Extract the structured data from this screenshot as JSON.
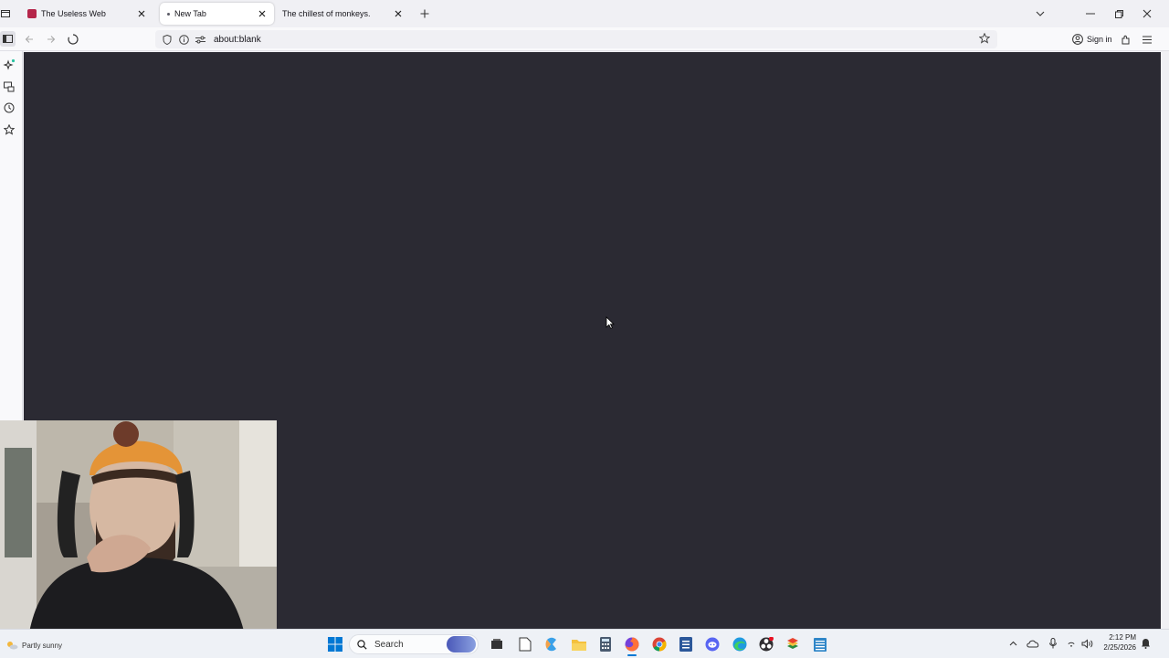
{
  "browser": {
    "tabs": [
      {
        "label": "The Useless Web",
        "active": false,
        "favicon_color": "#b5254a"
      },
      {
        "label": "New Tab",
        "active": true
      },
      {
        "label": "The chillest of monkeys.",
        "active": false
      }
    ],
    "url": "about:blank",
    "signin_label": "Sign in"
  },
  "taskbar": {
    "weather_label": "Partly sunny",
    "search_placeholder": "Search",
    "time": "2:12 PM",
    "date": "2/25/2026"
  },
  "colors": {
    "content_bg": "#2b2a33",
    "chrome_bg": "#f0f0f4",
    "taskbar_bg": "#eef1f6",
    "windows_blue": "#0078d4"
  },
  "icons": {
    "tabbar": [
      "tab-list-icon",
      "close-icon",
      "plus-icon",
      "chevron-down-icon",
      "minimize-icon",
      "maximize-icon"
    ],
    "navbar": [
      "back-icon",
      "forward-icon",
      "stop-icon",
      "shield-icon",
      "info-icon",
      "permissions-icon",
      "bookmark-star-icon",
      "account-icon",
      "extensions-icon",
      "menu-icon"
    ],
    "sidebar": [
      "sidebar-toggle-icon",
      "ai-chatbot-icon",
      "synced-tabs-icon",
      "history-icon",
      "bookmarks-icon"
    ],
    "taskbar": [
      "windows-start-icon",
      "search-icon",
      "widgets-icon",
      "task-view-icon",
      "notepad-icon",
      "copilot-icon",
      "file-explorer-icon",
      "calculator-icon",
      "firefox-icon",
      "chrome-icon",
      "word-icon",
      "discord-icon",
      "edge-icon",
      "obs-icon",
      "bluestacks-icon",
      "notepad-plus-icon",
      "chevron-up-icon",
      "onedrive-icon",
      "microphone-icon",
      "wifi-icon",
      "volume-icon",
      "notification-icon"
    ]
  }
}
